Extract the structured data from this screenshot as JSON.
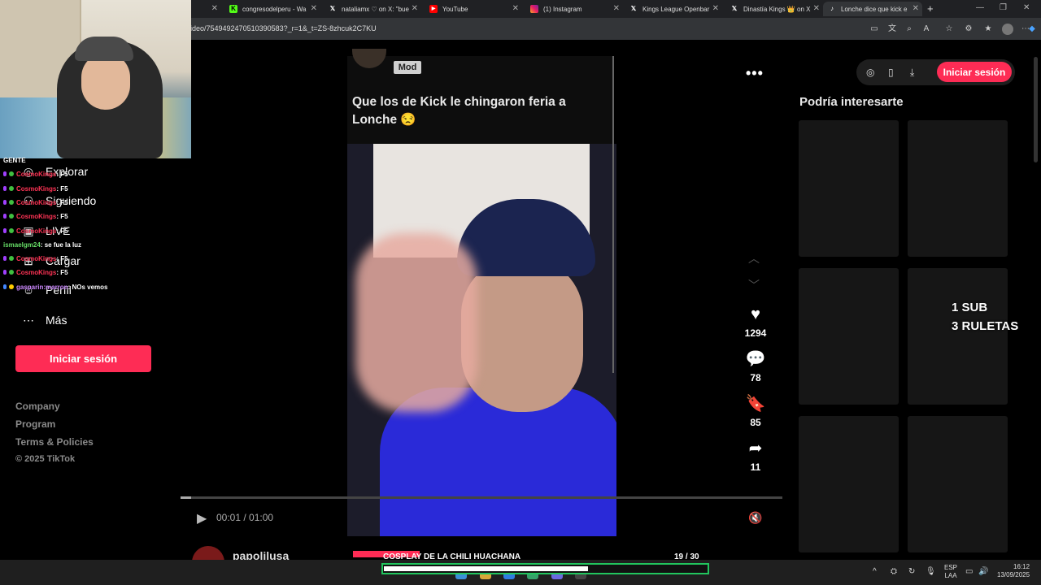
{
  "browser": {
    "tabs": [
      {
        "label": "",
        "active": false
      },
      {
        "label": "congresodelperu - Wa",
        "icon": "kick-icon"
      },
      {
        "label": "nataliamx ♡ on X: \"bue",
        "icon": "x-icon"
      },
      {
        "label": "YouTube",
        "icon": "youtube-icon"
      },
      {
        "label": "(1) Instagram",
        "icon": "instagram-icon"
      },
      {
        "label": "Kings League Openbar",
        "icon": "x-icon"
      },
      {
        "label": "Dinastía Kings 👑 on X",
        "icon": "x-icon"
      },
      {
        "label": "Lonche dice que kick e",
        "icon": "tiktok-icon",
        "active": true
      }
    ],
    "new_tab": "+",
    "url": "ideo/7549492470510390583?_r=1&_t=ZS-8zhcuk2C7KU"
  },
  "sidebar": {
    "items": [
      {
        "label": "Explorar",
        "icon": "compass-icon"
      },
      {
        "label": "Siguiendo",
        "icon": "user-icon"
      },
      {
        "label": "LIVE",
        "icon": "live-icon"
      },
      {
        "label": "Cargar",
        "icon": "upload-icon"
      },
      {
        "label": "Perfil",
        "icon": "profile-icon"
      },
      {
        "label": "Más",
        "icon": "more-icon"
      }
    ],
    "login_label": "Iniciar sesión",
    "footer": [
      "Company",
      "Program",
      "Terms & Policies",
      "© 2025 TikTok"
    ]
  },
  "chat": {
    "header": "GENTE",
    "lines": [
      {
        "user": "CosmoKings",
        "msg": ": F5",
        "color": "#ff3355"
      },
      {
        "user": "CosmoKings",
        "msg": ": F5",
        "color": "#ff3355"
      },
      {
        "user": "CosmoKings",
        "msg": ": F5",
        "color": "#ff3355"
      },
      {
        "user": "CosmoKings",
        "msg": ": F5",
        "color": "#ff3355"
      },
      {
        "user": "CosmoKings",
        "msg": ": F5",
        "color": "#ff3355"
      },
      {
        "user": "ismaelgm24",
        "msg": ": se fue la luz",
        "color": "#66dd66"
      },
      {
        "user": "CosmoKings",
        "msg": ": F5",
        "color": "#ff3355"
      },
      {
        "user": "CosmoKings",
        "msg": ": F5",
        "color": "#ff3355"
      },
      {
        "user": "gasparin:marron",
        "msg": ": NOs vemos",
        "color": "#cc88ff"
      }
    ]
  },
  "post": {
    "badge": "Mod",
    "caption": "Que los de Kick le chingaron feria a Lonche 😒",
    "time": "00:01 / 01:00",
    "progress": 0.017,
    "likes": "1294",
    "comments": "78",
    "saves": "85",
    "shares": "11",
    "next_username": "papolilusa"
  },
  "right_panel": {
    "login_label": "Iniciar sesión",
    "suggest_title": "Podría interesarte",
    "promo_line1": "1 SUB",
    "promo_line2": "3 RULETAS"
  },
  "stream_overlay": {
    "goal_label": "COSPLAY DE LA CHILI HUACHANA",
    "goal_count": "19  / 30",
    "goal_progress": 0.633
  },
  "taskbar": {
    "lang1": "ESP",
    "lang2": "LAA",
    "time": "16:12",
    "date": "13/09/2025"
  }
}
